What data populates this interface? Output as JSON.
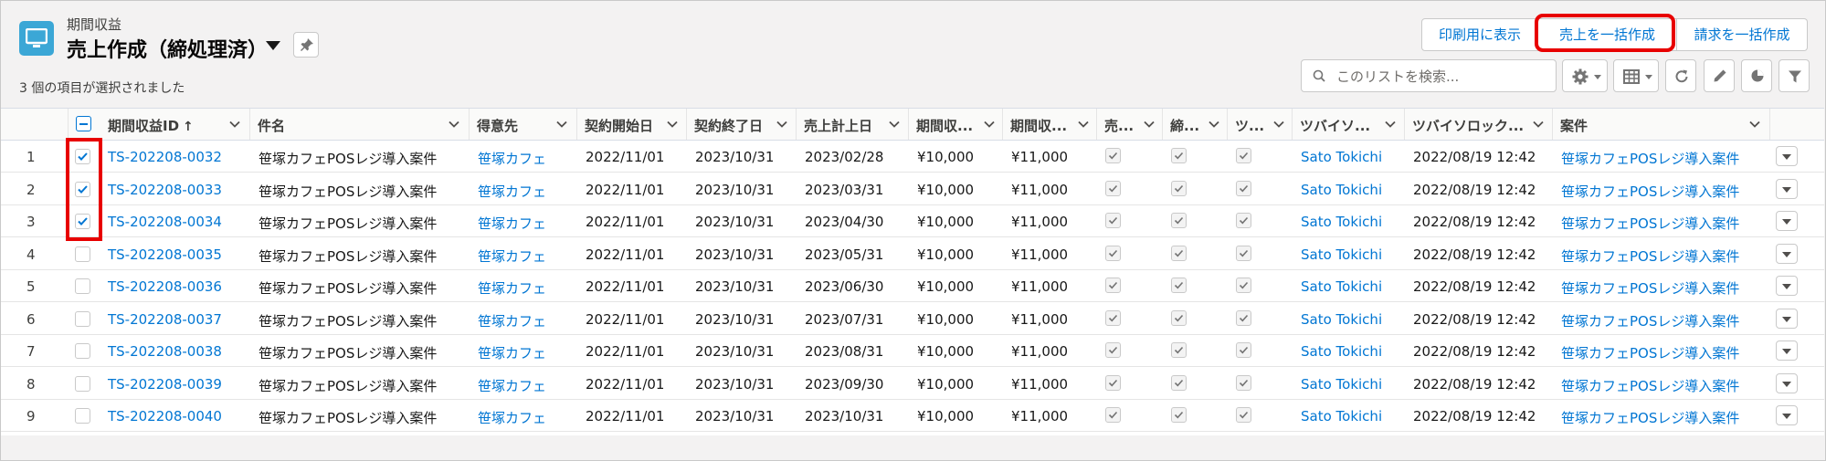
{
  "header": {
    "object_label": "期間収益",
    "list_title": "売上作成（締処理済）",
    "selected_info": "3 個の項目が選択されました"
  },
  "actions": {
    "print_label": "印刷用に表示",
    "create_sales_label": "売上を一括作成",
    "create_invoice_label": "請求を一括作成"
  },
  "search": {
    "placeholder": "このリストを検索..."
  },
  "columns": [
    {
      "label": "期間収益ID",
      "sort": "↑"
    },
    {
      "label": "件名"
    },
    {
      "label": "得意先"
    },
    {
      "label": "契約開始日"
    },
    {
      "label": "契約終了日"
    },
    {
      "label": "売上計上日"
    },
    {
      "label": "期間収..."
    },
    {
      "label": "期間収..."
    },
    {
      "label": "売..."
    },
    {
      "label": "締..."
    },
    {
      "label": "ツ..."
    },
    {
      "label": "ツバイソ..."
    },
    {
      "label": "ツバイソロック..."
    },
    {
      "label": "案件"
    }
  ],
  "rows": [
    {
      "num": "1",
      "selected": true,
      "id": "TS-202208-0032",
      "subject": "笹塚カフェPOSレジ導入案件",
      "customer": "笹塚カフェ",
      "start": "2022/11/01",
      "end": "2023/10/31",
      "sales_date": "2023/02/28",
      "amount1": "¥10,000",
      "amount2": "¥11,000",
      "user": "Sato Tokichi",
      "lock": "2022/08/19 12:42",
      "opportunity": "笹塚カフェPOSレジ導入案件"
    },
    {
      "num": "2",
      "selected": true,
      "id": "TS-202208-0033",
      "subject": "笹塚カフェPOSレジ導入案件",
      "customer": "笹塚カフェ",
      "start": "2022/11/01",
      "end": "2023/10/31",
      "sales_date": "2023/03/31",
      "amount1": "¥10,000",
      "amount2": "¥11,000",
      "user": "Sato Tokichi",
      "lock": "2022/08/19 12:42",
      "opportunity": "笹塚カフェPOSレジ導入案件"
    },
    {
      "num": "3",
      "selected": true,
      "id": "TS-202208-0034",
      "subject": "笹塚カフェPOSレジ導入案件",
      "customer": "笹塚カフェ",
      "start": "2022/11/01",
      "end": "2023/10/31",
      "sales_date": "2023/04/30",
      "amount1": "¥10,000",
      "amount2": "¥11,000",
      "user": "Sato Tokichi",
      "lock": "2022/08/19 12:42",
      "opportunity": "笹塚カフェPOSレジ導入案件"
    },
    {
      "num": "4",
      "selected": false,
      "id": "TS-202208-0035",
      "subject": "笹塚カフェPOSレジ導入案件",
      "customer": "笹塚カフェ",
      "start": "2022/11/01",
      "end": "2023/10/31",
      "sales_date": "2023/05/31",
      "amount1": "¥10,000",
      "amount2": "¥11,000",
      "user": "Sato Tokichi",
      "lock": "2022/08/19 12:42",
      "opportunity": "笹塚カフェPOSレジ導入案件"
    },
    {
      "num": "5",
      "selected": false,
      "id": "TS-202208-0036",
      "subject": "笹塚カフェPOSレジ導入案件",
      "customer": "笹塚カフェ",
      "start": "2022/11/01",
      "end": "2023/10/31",
      "sales_date": "2023/06/30",
      "amount1": "¥10,000",
      "amount2": "¥11,000",
      "user": "Sato Tokichi",
      "lock": "2022/08/19 12:42",
      "opportunity": "笹塚カフェPOSレジ導入案件"
    },
    {
      "num": "6",
      "selected": false,
      "id": "TS-202208-0037",
      "subject": "笹塚カフェPOSレジ導入案件",
      "customer": "笹塚カフェ",
      "start": "2022/11/01",
      "end": "2023/10/31",
      "sales_date": "2023/07/31",
      "amount1": "¥10,000",
      "amount2": "¥11,000",
      "user": "Sato Tokichi",
      "lock": "2022/08/19 12:42",
      "opportunity": "笹塚カフェPOSレジ導入案件"
    },
    {
      "num": "7",
      "selected": false,
      "id": "TS-202208-0038",
      "subject": "笹塚カフェPOSレジ導入案件",
      "customer": "笹塚カフェ",
      "start": "2022/11/01",
      "end": "2023/10/31",
      "sales_date": "2023/08/31",
      "amount1": "¥10,000",
      "amount2": "¥11,000",
      "user": "Sato Tokichi",
      "lock": "2022/08/19 12:42",
      "opportunity": "笹塚カフェPOSレジ導入案件"
    },
    {
      "num": "8",
      "selected": false,
      "id": "TS-202208-0039",
      "subject": "笹塚カフェPOSレジ導入案件",
      "customer": "笹塚カフェ",
      "start": "2022/11/01",
      "end": "2023/10/31",
      "sales_date": "2023/09/30",
      "amount1": "¥10,000",
      "amount2": "¥11,000",
      "user": "Sato Tokichi",
      "lock": "2022/08/19 12:42",
      "opportunity": "笹塚カフェPOSレジ導入案件"
    },
    {
      "num": "9",
      "selected": false,
      "id": "TS-202208-0040",
      "subject": "笹塚カフェPOSレジ導入案件",
      "customer": "笹塚カフェ",
      "start": "2022/11/01",
      "end": "2023/10/31",
      "sales_date": "2023/10/31",
      "amount1": "¥10,000",
      "amount2": "¥11,000",
      "user": "Sato Tokichi",
      "lock": "2022/08/19 12:42",
      "opportunity": "笹塚カフェPOSレジ導入案件"
    }
  ],
  "colors": {
    "accent": "#0176d3",
    "highlight": "#e80000",
    "object_icon": "#3ba7d6"
  },
  "icons": [
    "desktop-icon",
    "pin-icon",
    "search-icon",
    "gear-icon",
    "table-icon",
    "refresh-icon",
    "pencil-icon",
    "chart-icon",
    "filter-icon"
  ]
}
